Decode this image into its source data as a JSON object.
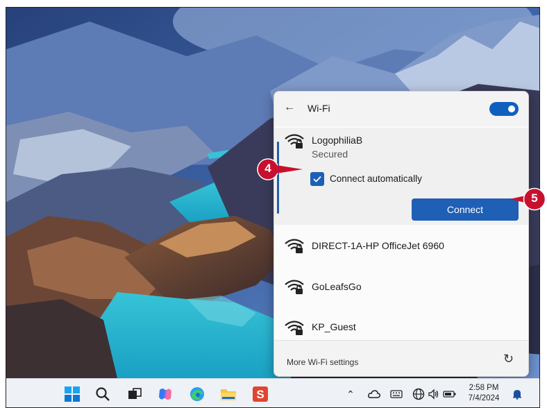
{
  "wifi_panel": {
    "title": "Wi-Fi",
    "toggle_on": true,
    "selected_network": {
      "name": "LogophiliaB",
      "status": "Secured",
      "connect_automatically_label": "Connect automatically",
      "connect_automatically_checked": true,
      "connect_button_label": "Connect"
    },
    "networks": [
      {
        "name": "DIRECT-1A-HP OfficeJet 6960"
      },
      {
        "name": "GoLeafsGo"
      },
      {
        "name": "KP_Guest"
      }
    ],
    "footer": {
      "more_settings_label": "More Wi-Fi settings"
    }
  },
  "callouts": {
    "step4": "4",
    "step5": "5"
  },
  "taskbar": {
    "clock_time": "2:58 PM",
    "clock_date": "7/4/2024"
  },
  "colors": {
    "accent": "#1f5fb5",
    "callout_red": "#c8102e",
    "toggle_blue": "#0f5fbf"
  }
}
